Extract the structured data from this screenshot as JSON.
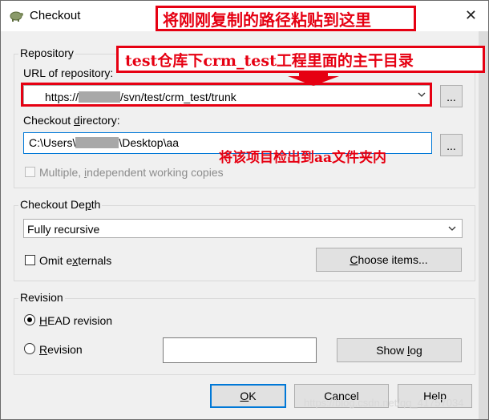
{
  "window": {
    "title": "Checkout"
  },
  "annotations": {
    "top": "将刚刚复制的路径粘贴到这里",
    "repo": "test仓库下crm_test工程里面的主干目录",
    "checkout": "将该项目检出到aa文件夹内"
  },
  "repository": {
    "group_label": "Repository",
    "url_label_pre": "URL of repository:",
    "url_prefix": "https://",
    "url_suffix": "/svn/test/crm_test/trunk",
    "dir_label_pre": "Checkout ",
    "dir_label_mn": "d",
    "dir_label_post": "irectory:",
    "dir_prefix": "C:\\Users\\",
    "dir_suffix": "\\Desktop\\aa",
    "browse_label": "...",
    "multiple_pre": "Multiple, ",
    "multiple_mn": "i",
    "multiple_post": "ndependent working copies"
  },
  "depth": {
    "group_label_pre": "Checkout De",
    "group_label_mn": "p",
    "group_label_post": "th",
    "selected": "Fully recursive",
    "omit_pre": "Omit e",
    "omit_mn": "x",
    "omit_post": "ternals",
    "choose_pre": "",
    "choose_mn": "C",
    "choose_post": "hoose items..."
  },
  "revision": {
    "group_label": "Revision",
    "head_pre": "",
    "head_mn": "H",
    "head_post": "EAD revision",
    "rev_pre": "",
    "rev_mn": "R",
    "rev_post": "evision",
    "rev_value": "",
    "showlog_pre": "Show ",
    "showlog_mn": "l",
    "showlog_post": "og"
  },
  "buttons": {
    "ok_mn": "O",
    "ok_post": "K",
    "cancel": "Cancel",
    "help": "Help"
  },
  "watermark": "https://blog.csdn.net/qq_41757034"
}
